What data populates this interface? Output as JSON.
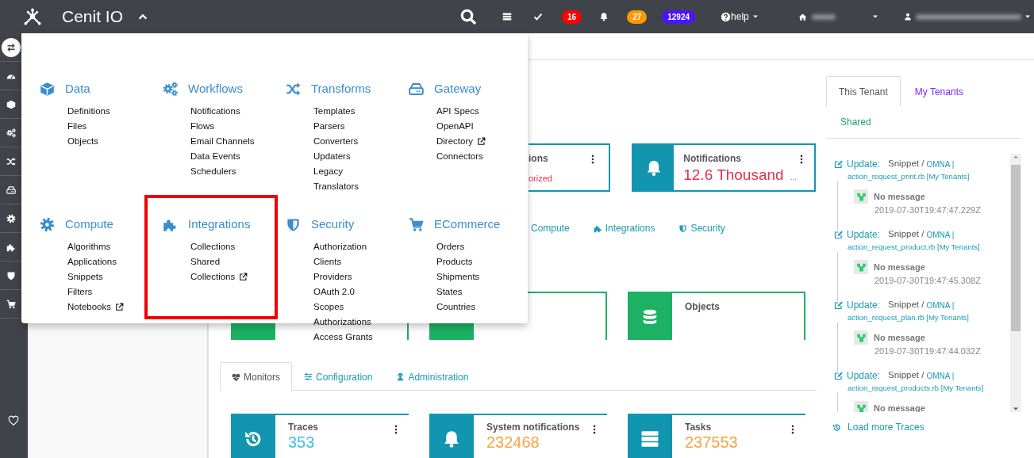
{
  "navbar": {
    "brand": "Cenit IO",
    "badges": [
      {
        "text": "16",
        "color": "#ff0000"
      },
      {
        "text": "27",
        "color": "#ff9800"
      },
      {
        "text": "12924",
        "color": "#4a14ff"
      }
    ],
    "help": "help"
  },
  "sidebar": {
    "items": [
      {
        "selected": true
      },
      {
        "selected": false
      },
      {
        "selected": false
      },
      {
        "selected": false
      },
      {
        "selected": false
      },
      {
        "selected": false
      },
      {
        "selected": false
      },
      {
        "selected": false
      },
      {
        "selected": false
      },
      {
        "selected": false
      }
    ]
  },
  "menu": {
    "groups": [
      {
        "title": "Data",
        "highlighted": false,
        "items": [
          {
            "label": "Definitions",
            "external": false
          },
          {
            "label": "Files",
            "external": false
          },
          {
            "label": "Objects",
            "external": false
          }
        ]
      },
      {
        "title": "Workflows",
        "highlighted": false,
        "items": [
          {
            "label": "Notifications",
            "external": false
          },
          {
            "label": "Flows",
            "external": false
          },
          {
            "label": "Email Channels",
            "external": false
          },
          {
            "label": "Data Events",
            "external": false
          },
          {
            "label": "Schedulers",
            "external": false
          }
        ]
      },
      {
        "title": "Transforms",
        "highlighted": false,
        "items": [
          {
            "label": "Templates",
            "external": false
          },
          {
            "label": "Parsers",
            "external": false
          },
          {
            "label": "Converters",
            "external": false
          },
          {
            "label": "Updaters",
            "external": false
          },
          {
            "label": "Legacy",
            "external": false
          },
          {
            "label": "Translators",
            "external": false
          }
        ]
      },
      {
        "title": "Gateway",
        "highlighted": false,
        "items": [
          {
            "label": "API Specs",
            "external": false
          },
          {
            "label": "OpenAPI",
            "external": false
          },
          {
            "label": "Directory",
            "external": true
          },
          {
            "label": "Connectors",
            "external": false
          }
        ]
      },
      {
        "title": "Compute",
        "highlighted": false,
        "items": [
          {
            "label": "Algorithms",
            "external": false
          },
          {
            "label": "Applications",
            "external": false
          },
          {
            "label": "Snippets",
            "external": false
          },
          {
            "label": "Filters",
            "external": false
          },
          {
            "label": "Notebooks",
            "external": true
          }
        ]
      },
      {
        "title": "Integrations",
        "highlighted": true,
        "items": [
          {
            "label": "Collections",
            "external": false
          },
          {
            "label": "Shared",
            "external": false
          },
          {
            "label": "Collections",
            "external": true
          }
        ]
      },
      {
        "title": "Security",
        "highlighted": false,
        "items": [
          {
            "label": "Authorization",
            "external": false
          },
          {
            "label": "Clients",
            "external": false
          },
          {
            "label": "Providers",
            "external": false
          },
          {
            "label": "OAuth 2.0",
            "external": false
          },
          {
            "label": "Scopes",
            "external": false
          },
          {
            "label": "Authorizations",
            "external": false
          },
          {
            "label": "Access Grants",
            "external": false
          }
        ]
      },
      {
        "title": "ECommerce",
        "highlighted": false,
        "items": [
          {
            "label": "Orders",
            "external": false
          },
          {
            "label": "Products",
            "external": false
          },
          {
            "label": "Shipments",
            "external": false
          },
          {
            "label": "States",
            "external": false
          },
          {
            "label": "Countries",
            "external": false
          }
        ]
      }
    ]
  },
  "summary_cards": [
    {
      "kind": "partial",
      "title": "ions",
      "subtitle": "orized"
    },
    {
      "kind": "full",
      "title": "Notifications",
      "value": "12.6 Thousand",
      "more": "..."
    }
  ],
  "section_links": [
    "Compute",
    "Integrations",
    "Security"
  ],
  "object_cards": [
    {
      "kind": "tile"
    },
    {
      "kind": "tile"
    },
    {
      "kind": "card",
      "title": "Objects"
    }
  ],
  "tabs": [
    {
      "label": "Monitors",
      "selected": true
    },
    {
      "label": "Configuration",
      "selected": false
    },
    {
      "label": "Administration",
      "selected": false
    }
  ],
  "monitor_cards": [
    {
      "title": "Traces",
      "value": "353",
      "color": "#3fc1e3"
    },
    {
      "title": "System notifications",
      "value": "232468",
      "color": "#f7a541"
    },
    {
      "title": "Tasks",
      "value": "237553",
      "color": "#f7a541"
    }
  ],
  "tenant_tabs": [
    {
      "label": "This Tenant",
      "selected": true,
      "color": "#555555"
    },
    {
      "label": "My Tenants",
      "selected": false,
      "color": "#7a2bf5"
    },
    {
      "label": "Shared",
      "selected": false,
      "color": "#25a06e"
    }
  ],
  "traces": [
    {
      "action": "Update:",
      "type": "Snippet /",
      "namespace": "OMNA |",
      "name": "action_request_print.rb [My Tenants]",
      "message": "No message",
      "time": "2019-07-30T19:47:47.229Z"
    },
    {
      "action": "Update:",
      "type": "Snippet /",
      "namespace": "OMNA |",
      "name": "action_request_product.rb [My Tenants]",
      "message": "No message",
      "time": "2019-07-30T19:47:45.308Z"
    },
    {
      "action": "Update:",
      "type": "Snippet /",
      "namespace": "OMNA |",
      "name": "action_request_plan.rb [My Tenants]",
      "message": "No message",
      "time": "2019-07-30T19:47:44.032Z"
    },
    {
      "action": "Update:",
      "type": "Snippet /",
      "namespace": "OMNA |",
      "name": "action_request_products.rb [My Tenants]",
      "message": "No message"
    }
  ],
  "load_more": "Load more Traces"
}
